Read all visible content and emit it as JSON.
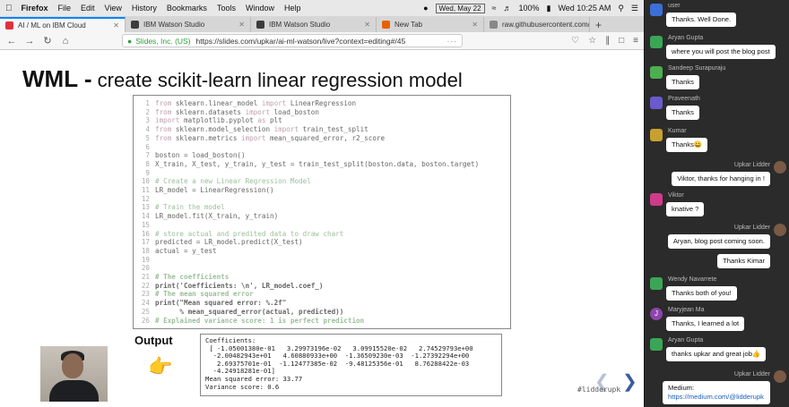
{
  "menubar": {
    "app": "Firefox",
    "menus": [
      "File",
      "Edit",
      "View",
      "History",
      "Bookmarks",
      "Tools",
      "Window",
      "Help"
    ],
    "date": "Wed, May 22",
    "battery": "100%",
    "clock": "Wed 10:25 AM"
  },
  "tabs": [
    {
      "label": "AI / ML on IBM Cloud",
      "color": "#e0323c",
      "active": true
    },
    {
      "label": "IBM Watson Studio",
      "color": "#3c3c3c",
      "active": false
    },
    {
      "label": "IBM Watson Studio",
      "color": "#3c3c3c",
      "active": false
    },
    {
      "label": "New Tab",
      "color": "#e66000",
      "active": false
    },
    {
      "label": "raw.githubusercontent.com/lidd",
      "color": "#888888",
      "active": false
    }
  ],
  "navbar": {
    "org": "Slides, Inc. (US)",
    "url": "https://slides.com/upkar/ai-ml-watson/live?context=editing#/45"
  },
  "slide": {
    "title_bold": "WML -",
    "title_rest": " create scikit-learn linear regression model",
    "code": [
      {
        "n": "1",
        "parts": [
          {
            "t": "from ",
            "c": "kw"
          },
          {
            "t": "sklearn.linear_model ",
            "c": "plain"
          },
          {
            "t": "import ",
            "c": "kw"
          },
          {
            "t": "LinearRegression",
            "c": "plain"
          }
        ]
      },
      {
        "n": "2",
        "parts": [
          {
            "t": "from ",
            "c": "kw"
          },
          {
            "t": "sklearn.datasets ",
            "c": "plain"
          },
          {
            "t": "import ",
            "c": "kw"
          },
          {
            "t": "load_boston",
            "c": "plain"
          }
        ]
      },
      {
        "n": "3",
        "parts": [
          {
            "t": "import ",
            "c": "kw"
          },
          {
            "t": "matplotlib.pyplot ",
            "c": "plain"
          },
          {
            "t": "as ",
            "c": "kw"
          },
          {
            "t": "plt",
            "c": "plain"
          }
        ]
      },
      {
        "n": "4",
        "parts": [
          {
            "t": "from ",
            "c": "kw"
          },
          {
            "t": "sklearn.model_selection ",
            "c": "plain"
          },
          {
            "t": "import ",
            "c": "kw"
          },
          {
            "t": "train_test_split",
            "c": "plain"
          }
        ]
      },
      {
        "n": "5",
        "parts": [
          {
            "t": "from ",
            "c": "kw"
          },
          {
            "t": "sklearn.metrics ",
            "c": "plain"
          },
          {
            "t": "import ",
            "c": "kw"
          },
          {
            "t": "mean_squared_error, r2_score",
            "c": "plain"
          }
        ]
      },
      {
        "n": "6",
        "parts": []
      },
      {
        "n": "7",
        "parts": [
          {
            "t": "boston = load_boston()",
            "c": "plain"
          }
        ]
      },
      {
        "n": "8",
        "parts": [
          {
            "t": "X_train, X_test, y_train, y_test = train_test_split(boston.data, boston.target)",
            "c": "plain"
          }
        ]
      },
      {
        "n": "9",
        "parts": []
      },
      {
        "n": "10",
        "parts": [
          {
            "t": "# Create a new Linear Regression Model",
            "c": "cm"
          }
        ]
      },
      {
        "n": "11",
        "parts": [
          {
            "t": "LR_model = LinearRegression()",
            "c": "plain"
          }
        ]
      },
      {
        "n": "12",
        "parts": []
      },
      {
        "n": "13",
        "parts": [
          {
            "t": "# Train the model",
            "c": "cm"
          }
        ]
      },
      {
        "n": "14",
        "parts": [
          {
            "t": "LR_model.fit(X_train, y_train)",
            "c": "plain"
          }
        ]
      },
      {
        "n": "15",
        "parts": []
      },
      {
        "n": "16",
        "parts": [
          {
            "t": "# store actual and predited data to draw chart",
            "c": "cm"
          }
        ]
      },
      {
        "n": "17",
        "parts": [
          {
            "t": "predicted = LR_model.predict(X_test)",
            "c": "plain"
          }
        ]
      },
      {
        "n": "18",
        "parts": [
          {
            "t": "actual = y_test",
            "c": "plain"
          }
        ]
      },
      {
        "n": "19",
        "parts": []
      },
      {
        "n": "20",
        "parts": []
      },
      {
        "n": "21",
        "bold": true,
        "parts": [
          {
            "t": "# The coefficients",
            "c": "cm"
          }
        ]
      },
      {
        "n": "22",
        "bold": true,
        "parts": [
          {
            "t": "print('Coefficients: \\n', LR_model.coef_)",
            "c": "plain"
          }
        ]
      },
      {
        "n": "23",
        "bold": true,
        "parts": [
          {
            "t": "# The mean squared error",
            "c": "cm"
          }
        ]
      },
      {
        "n": "24",
        "bold": true,
        "parts": [
          {
            "t": "print(\"Mean squared error: %.2f\"",
            "c": "plain"
          }
        ]
      },
      {
        "n": "25",
        "bold": true,
        "parts": [
          {
            "t": "      % mean_squared_error(actual, predicted))",
            "c": "plain"
          }
        ]
      },
      {
        "n": "26",
        "bold": true,
        "parts": [
          {
            "t": "# Explained variance score: 1 is perfect prediction",
            "c": "cm"
          }
        ]
      }
    ],
    "output_label": "Output",
    "output": [
      "Coefficients:",
      " [ -1.05001380e-01   3.29973196e-02   3.09915520e-02   2.74529793e+00",
      "  -2.00482943e+01   4.60880933e+00  -1.36509230e-03  -1.27392294e+00",
      "   2.69375701e-01  -1.12477385e-02  -9.48125356e-01   8.76288422e-03",
      "  -4.24918281e-01]",
      "Mean squared error: 33.77",
      "Variance score: 0.6"
    ],
    "hashtag": "#lidderupk"
  },
  "chat": [
    {
      "user": "user",
      "text": "Thanks. Well Done.",
      "side": "left",
      "avatar": "#3a6fd8"
    },
    {
      "user": "Aryan Gupta",
      "text": "where you will post the blog post",
      "side": "left",
      "avatar": "#3aa655"
    },
    {
      "user": "Sandeep Surapuraju",
      "text": "Thanks",
      "side": "left",
      "avatar": "#4caf50"
    },
    {
      "user": "Praveenath",
      "text": "Thanks",
      "side": "left",
      "avatar": "#6a5acd"
    },
    {
      "user": "Kumar",
      "text": "Thanks😀",
      "side": "left",
      "avatar": "#c8a030"
    },
    {
      "user": "Upkar Lidder",
      "text": "Viktor, thanks for hanging in !",
      "side": "right"
    },
    {
      "user": "Viktor",
      "text": "knative ?",
      "side": "left",
      "avatar": "#d03a8a"
    },
    {
      "user": "Upkar Lidder",
      "text": "Aryan, blog post coming soon.",
      "side": "right"
    },
    {
      "user": "",
      "text": "Thanks Kimar",
      "side": "right"
    },
    {
      "user": "Wendy Navarrete",
      "text": "Thanks both of you!",
      "side": "left",
      "avatar": "#3aa655"
    },
    {
      "user": "Maryjean Ma",
      "text": "Thanks, I learned a lot",
      "side": "left",
      "avatar": "#8e44ad",
      "initial": "J"
    },
    {
      "user": "Aryan Gupta",
      "text": "thanks upkar and great job👍",
      "side": "left",
      "avatar": "#3aa655"
    },
    {
      "user": "Upkar Lidder",
      "text": "Medium:",
      "link": "https://medium.com/@lidderupk",
      "side": "right"
    }
  ]
}
